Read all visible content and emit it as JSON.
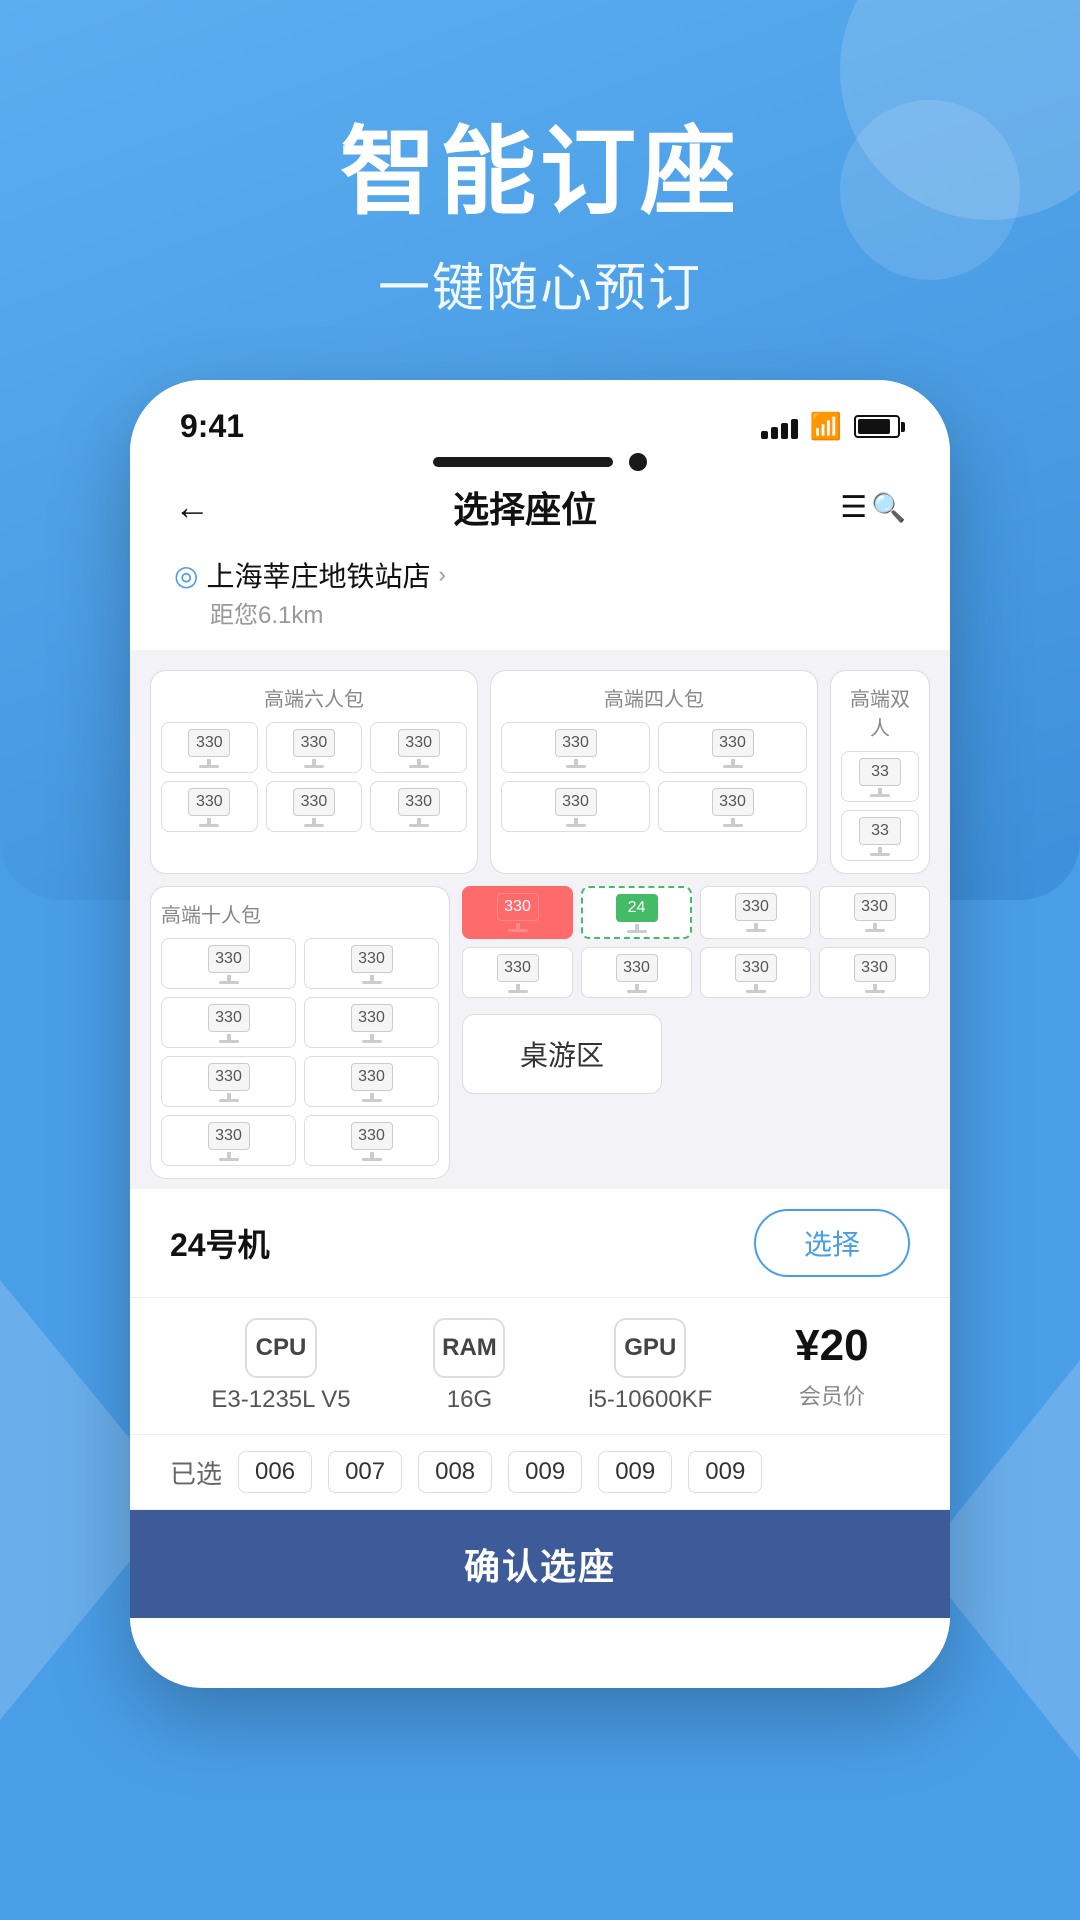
{
  "hero": {
    "title": "智能订座",
    "subtitle": "一键随心预订"
  },
  "status_bar": {
    "time": "9:41"
  },
  "nav": {
    "title": "选择座位"
  },
  "location": {
    "name": "上海莘庄地铁站店",
    "arrow": "›",
    "distance": "距您6.1km"
  },
  "rooms": [
    {
      "label": "高端六人包",
      "seats": [
        "330",
        "330",
        "330",
        "330",
        "330",
        "330"
      ]
    },
    {
      "label": "高端四人包",
      "seats": [
        "330",
        "330",
        "330",
        "330"
      ]
    },
    {
      "label": "高端双人"
    }
  ],
  "large_room": {
    "label": "高端十人包",
    "left_seats": [
      "330",
      "330",
      "330",
      "330",
      "330",
      "330",
      "330",
      "330"
    ],
    "right_rows": [
      [
        "330",
        "24",
        "330",
        "330"
      ],
      [
        "330",
        "330",
        "330",
        "330"
      ]
    ]
  },
  "board_game": "桌游区",
  "machine": {
    "number": "24号机",
    "select_btn": "选择"
  },
  "specs": [
    {
      "icon": "CPU",
      "value": "E3-1235L V5"
    },
    {
      "icon": "RAM",
      "value": "16G"
    },
    {
      "icon": "GPU",
      "value": "i5-10600KF"
    }
  ],
  "price": {
    "symbol": "¥",
    "amount": "20",
    "label": "会员价"
  },
  "selected_seats": {
    "label": "已选",
    "seats": [
      "006",
      "007",
      "008",
      "009",
      "009",
      "009"
    ]
  },
  "confirm_btn": "确认选座"
}
